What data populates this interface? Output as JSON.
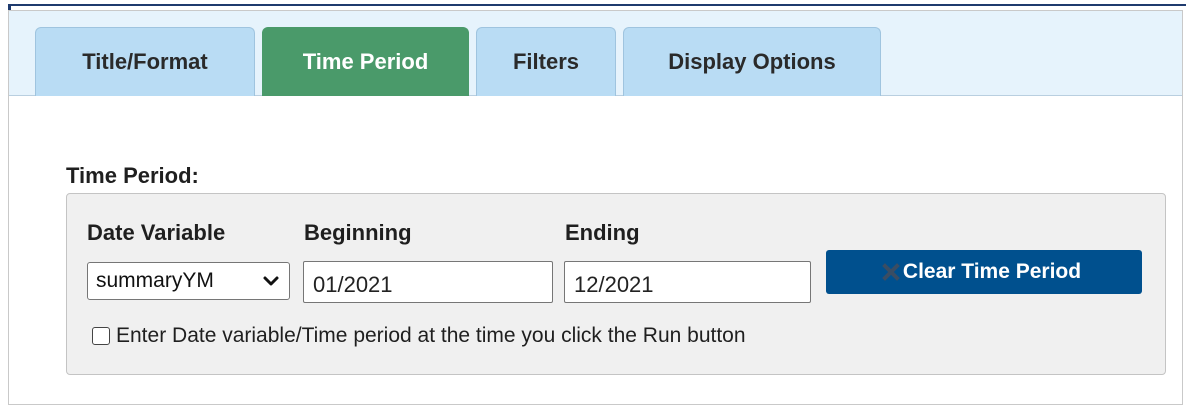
{
  "tabs": [
    {
      "label": "Title/Format",
      "active": false
    },
    {
      "label": "Time Period",
      "active": true
    },
    {
      "label": "Filters",
      "active": false
    },
    {
      "label": "Display Options",
      "active": false
    }
  ],
  "time_period": {
    "section_label": "Time Period:",
    "date_variable": {
      "label": "Date Variable",
      "selected": "summaryYM"
    },
    "beginning": {
      "label": "Beginning",
      "value": "01/2021"
    },
    "ending": {
      "label": "Ending",
      "value": "12/2021"
    },
    "clear_button": "Clear Time Period",
    "prompt_checkbox": {
      "label": "Enter Date variable/Time period at the time you click the Run button",
      "checked": false
    }
  },
  "icons": {
    "clear": "close-icon",
    "dropdown": "chevron-down-icon"
  },
  "colors": {
    "active_tab": "#4a9a6a",
    "inactive_tab": "#b9dcf4",
    "tab_bar": "#e6f3fc",
    "primary_button": "#00508e",
    "fieldset_bg": "#f0f0f0"
  }
}
